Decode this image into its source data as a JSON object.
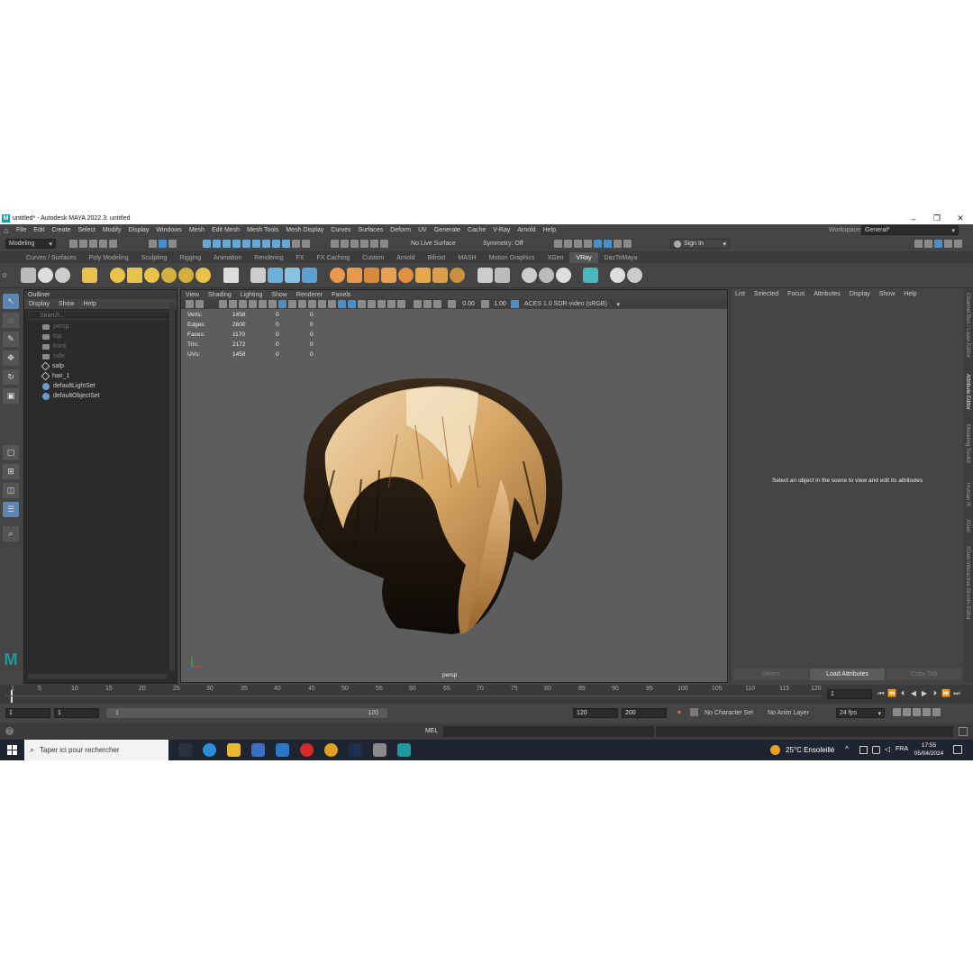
{
  "window": {
    "title": "untitled* - Autodesk MAYA 2022.3: untitled",
    "logo_letter": "M",
    "controls": [
      "–",
      "❐",
      "✕"
    ]
  },
  "menubar": {
    "items": [
      "File",
      "Edit",
      "Create",
      "Select",
      "Modify",
      "Display",
      "Windows",
      "Mesh",
      "Edit Mesh",
      "Mesh Tools",
      "Mesh Display",
      "Curves",
      "Surfaces",
      "Deform",
      "UV",
      "Generate",
      "Cache",
      "V-Ray",
      "Arnold",
      "Help"
    ],
    "workspace_label": "Workspace:",
    "workspace_value": "General*"
  },
  "statusline": {
    "menuset": "Modeling",
    "live_surface": "No Live Surface",
    "symmetry": "Symmetry: Off",
    "sign_in": "Sign In"
  },
  "shelf": {
    "tabs": [
      "Curves / Surfaces",
      "Poly Modeling",
      "Sculpting",
      "Rigging",
      "Animation",
      "Rendering",
      "FX",
      "FX Caching",
      "Custom",
      "Arnold",
      "Bifrost",
      "MASH",
      "Motion Graphics",
      "XGen",
      "VRay",
      "DazToMaya"
    ],
    "active_tab": "VRay"
  },
  "outliner": {
    "title": "Outliner",
    "menu": [
      "Display",
      "Show",
      "Help"
    ],
    "search_placeholder": "Search...",
    "items": [
      {
        "label": "persp",
        "kind": "camera"
      },
      {
        "label": "top",
        "kind": "camera"
      },
      {
        "label": "front",
        "kind": "camera"
      },
      {
        "label": "side",
        "kind": "camera"
      },
      {
        "label": "salp",
        "kind": "transform"
      },
      {
        "label": "hair_1",
        "kind": "transform"
      },
      {
        "label": "defaultLightSet",
        "kind": "set"
      },
      {
        "label": "defaultObjectSet",
        "kind": "set"
      }
    ]
  },
  "viewport": {
    "menu": [
      "View",
      "Shading",
      "Lighting",
      "Show",
      "Renderer",
      "Panels"
    ],
    "exposure": "0.00",
    "gamma": "1.00",
    "colorspace": "ACES 1.0 SDR-video (sRGB)",
    "camera_label": "persp",
    "hud": [
      {
        "label": "Verts:",
        "v1": "1458",
        "v2": "0",
        "v3": "0"
      },
      {
        "label": "Edges:",
        "v1": "2600",
        "v2": "0",
        "v3": "0"
      },
      {
        "label": "Faces:",
        "v1": "1170",
        "v2": "0",
        "v3": "0"
      },
      {
        "label": "Tris:",
        "v1": "2172",
        "v2": "0",
        "v3": "0"
      },
      {
        "label": "UVs:",
        "v1": "1458",
        "v2": "0",
        "v3": "0"
      }
    ]
  },
  "attribute_editor": {
    "menu": [
      "List",
      "Selected",
      "Focus",
      "Attributes",
      "Display",
      "Show",
      "Help"
    ],
    "message": "Select an object in the scene to view and edit its attributes",
    "buttons": [
      "Select",
      "Load Attributes",
      "Copy Tab"
    ]
  },
  "side_tabs": [
    "Channel Box / Layer Editor",
    "Attribute Editor",
    "Modeling Toolkit",
    "Human IK",
    "XGen",
    "XGen Interactive Groom Editor"
  ],
  "timeline": {
    "ticks": [
      "1",
      "5",
      "10",
      "15",
      "20",
      "25",
      "30",
      "35",
      "40",
      "45",
      "50",
      "55",
      "60",
      "65",
      "70",
      "75",
      "80",
      "85",
      "90",
      "95",
      "100",
      "105",
      "110",
      "115",
      "120"
    ],
    "current_frame": "1"
  },
  "range": {
    "start": "1",
    "anim_start": "1",
    "slider_start": "1",
    "slider_end": "120",
    "end": "120",
    "anim_end": "200",
    "character_set": "No Character Set",
    "anim_layer": "No Anim Layer",
    "fps": "24 fps"
  },
  "cmdline": {
    "lang": "MEL"
  },
  "taskbar": {
    "search_placeholder": "Taper ici pour rechercher",
    "weather": "25°C  Ensoleillé",
    "lang": "FRA",
    "time": "17:55",
    "date": "05/04/2024"
  },
  "colors": {
    "maya_teal": "#1b9aa0",
    "panel": "#444444",
    "viewport_bg": "#5d5d5d",
    "hair_light": "#e8c99a",
    "hair_dark": "#1a120c"
  }
}
